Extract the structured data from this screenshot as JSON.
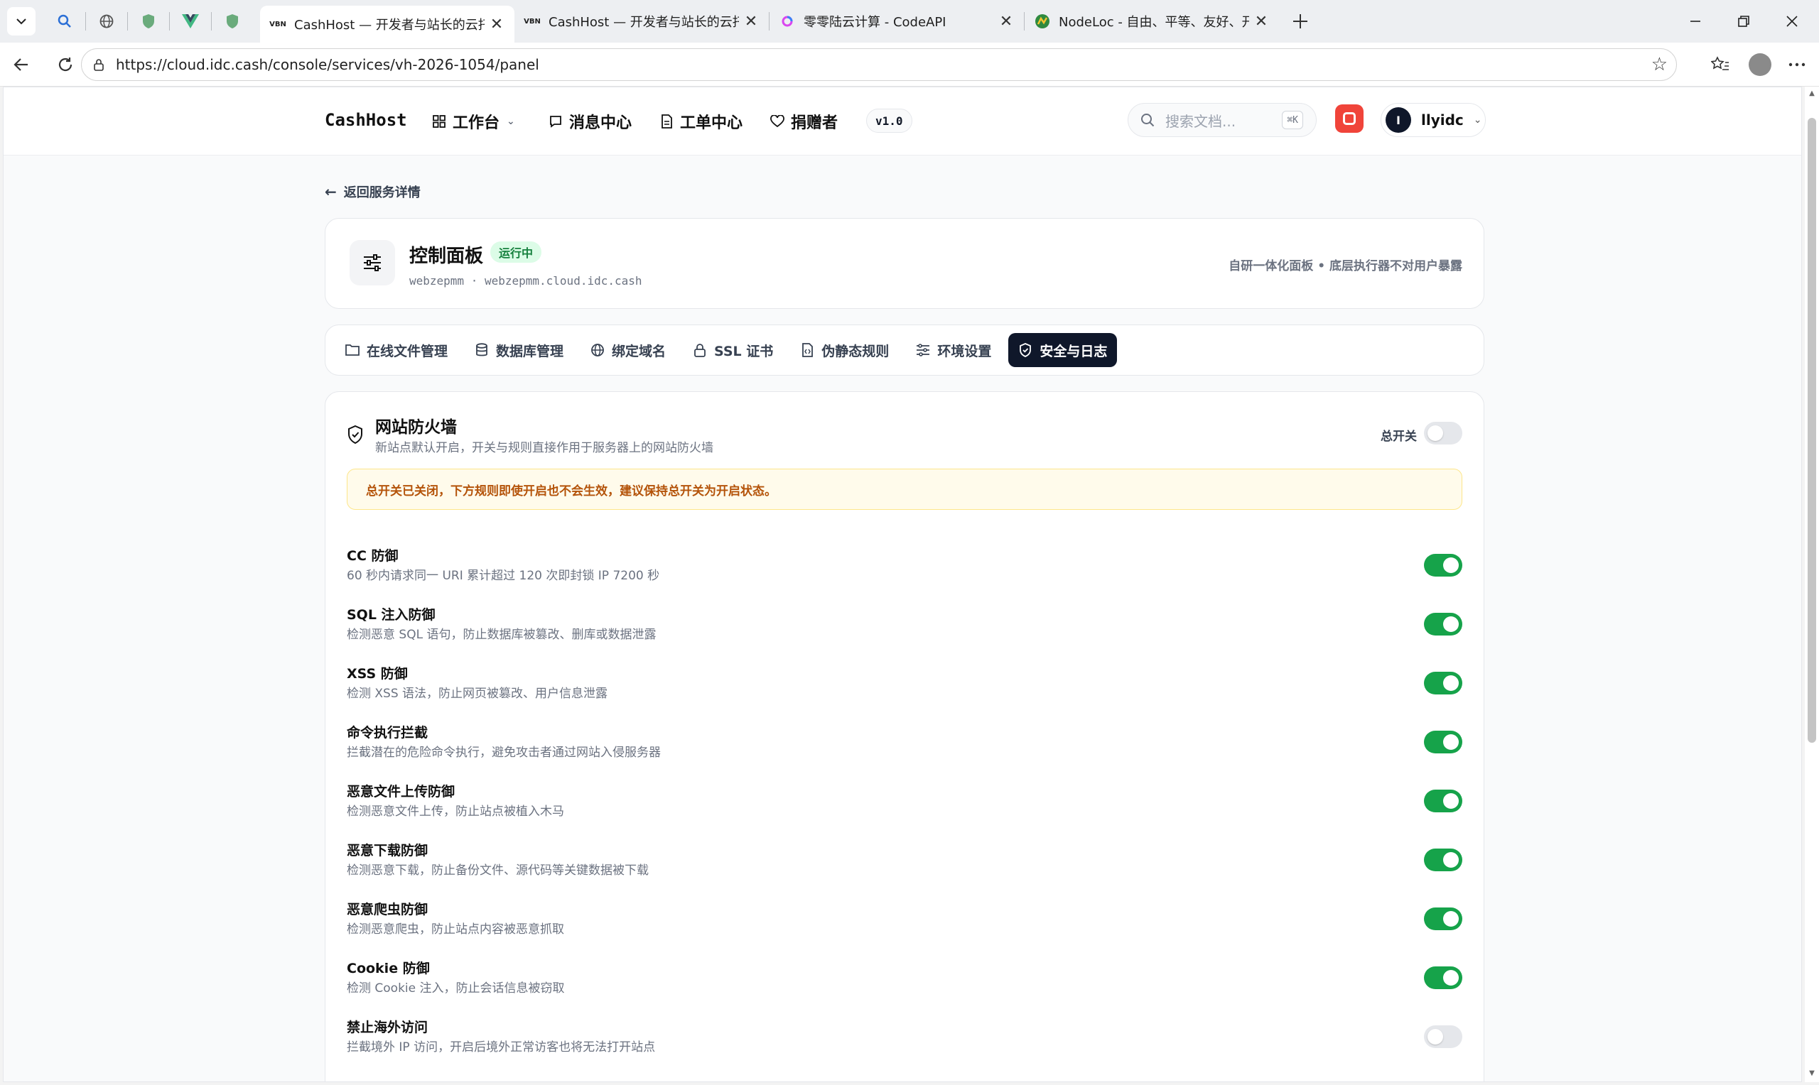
{
  "browser": {
    "tabs": [
      {
        "title": "CashHost — 开发者与站长的云托管",
        "active": true
      },
      {
        "title": "CashHost — 开发者与站长的云托管",
        "active": false
      },
      {
        "title": "零零陆云计算 - CodeAPI",
        "active": false
      },
      {
        "title": "NodeLoc - 自由、平等、友好、开放",
        "active": false
      }
    ],
    "url": "https://cloud.idc.cash/console/services/vh-2026-1054/panel"
  },
  "header": {
    "brand": "CashHost",
    "nav": [
      {
        "label": "工作台",
        "icon": "grid-icon"
      },
      {
        "label": "消息中心",
        "icon": "chat-icon"
      },
      {
        "label": "工单中心",
        "icon": "document-icon"
      },
      {
        "label": "捐赠者",
        "icon": "heart-icon"
      }
    ],
    "version": "v1.0",
    "search_placeholder": "搜索文档...",
    "search_shortcut": "⌘K",
    "user_initial": "I",
    "username": "llyidc"
  },
  "back_link": "返回服务详情",
  "panel": {
    "title": "控制面板",
    "status": "运行中",
    "subtitle": "webzepmm · webzepmm.cloud.idc.cash",
    "note": "自研一体化面板 • 底层执行器不对用户暴露"
  },
  "panel_tabs": [
    {
      "label": "在线文件管理",
      "icon": "folder-icon",
      "active": false
    },
    {
      "label": "数据库管理",
      "icon": "database-icon",
      "active": false
    },
    {
      "label": "绑定域名",
      "icon": "globe-icon",
      "active": false
    },
    {
      "label": "SSL 证书",
      "icon": "lock-icon",
      "active": false
    },
    {
      "label": "伪静态规则",
      "icon": "file-code-icon",
      "active": false
    },
    {
      "label": "环境设置",
      "icon": "sliders-icon",
      "active": false
    },
    {
      "label": "安全与日志",
      "icon": "shield-icon",
      "active": true
    }
  ],
  "firewall": {
    "title": "网站防火墙",
    "subtitle": "新站点默认开启，开关与规则直接作用于服务器上的网站防火墙",
    "master_label": "总开关",
    "master_on": false,
    "warning": "总开关已关闭，下方规则即使开启也不会生效，建议保持总开关为开启状态。",
    "rules": [
      {
        "name": "CC 防御",
        "desc": "60 秒内请求同一 URI 累计超过 120 次即封锁 IP 7200 秒",
        "on": true
      },
      {
        "name": "SQL 注入防御",
        "desc": "检测恶意 SQL 语句，防止数据库被篡改、删库或数据泄露",
        "on": true
      },
      {
        "name": "XSS 防御",
        "desc": "检测 XSS 语法，防止网页被篡改、用户信息泄露",
        "on": true
      },
      {
        "name": "命令执行拦截",
        "desc": "拦截潜在的危险命令执行，避免攻击者通过网站入侵服务器",
        "on": true
      },
      {
        "name": "恶意文件上传防御",
        "desc": "检测恶意文件上传，防止站点被植入木马",
        "on": true
      },
      {
        "name": "恶意下载防御",
        "desc": "检测恶意下载，防止备份文件、源代码等关键数据被下载",
        "on": true
      },
      {
        "name": "恶意爬虫防御",
        "desc": "检测恶意爬虫，防止站点内容被恶意抓取",
        "on": true
      },
      {
        "name": "Cookie 防御",
        "desc": "检测 Cookie 注入，防止会话信息被窃取",
        "on": true
      },
      {
        "name": "禁止海外访问",
        "desc": "拦截境外 IP 访问，开启后境外正常访客也将无法打开站点",
        "on": false
      }
    ]
  },
  "colors": {
    "accent_dark": "#0f172a",
    "toggle_on": "#16a34a",
    "warning_text": "#b45309",
    "status_green": "#15803d",
    "notify_red": "#f0443a"
  }
}
